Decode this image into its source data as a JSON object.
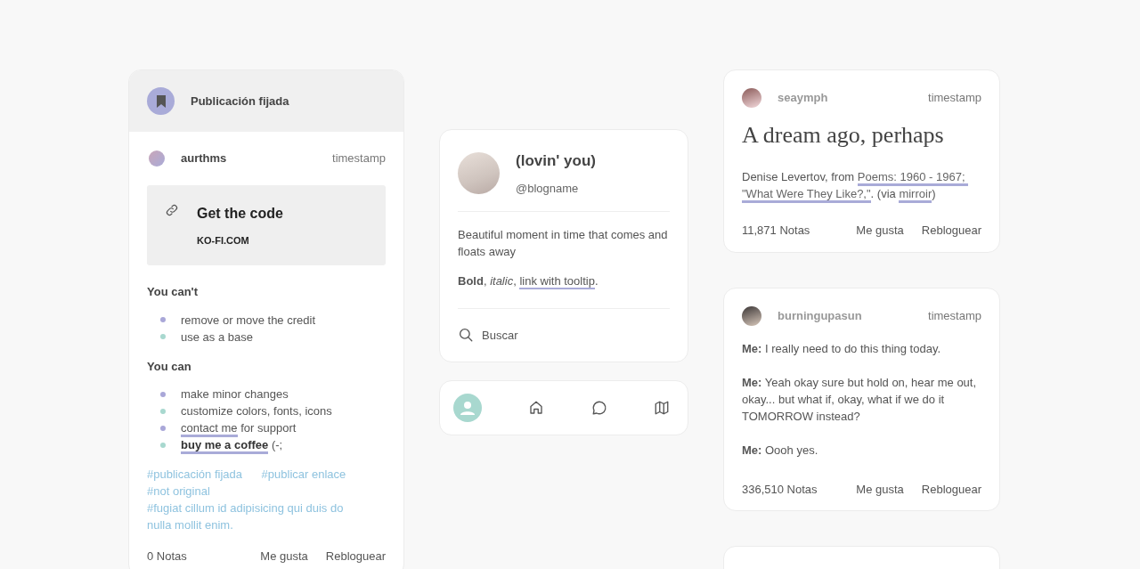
{
  "pinned_post": {
    "header": "Publicación fijada",
    "author": "aurthms",
    "timestamp": "timestamp",
    "link_card": {
      "title": "Get the code",
      "url": "KO-FI.COM"
    },
    "sections": [
      {
        "heading": "You can't",
        "items": [
          {
            "text": "remove or move the credit",
            "color": "#a9a7d8"
          },
          {
            "text": "use as a base",
            "color": "#a8d8cf"
          }
        ]
      },
      {
        "heading": "You can",
        "items": [
          {
            "text": "make minor changes",
            "color": "#a9a7d8"
          },
          {
            "text": "customize colors, fonts, icons",
            "color": "#a8d8cf"
          },
          {
            "link": "contact me",
            "text": " for support",
            "bold": false,
            "color": "#a9a7d8"
          },
          {
            "link": "buy me a coffee",
            "text": " (-;",
            "bold": true,
            "color": "#a8d8cf"
          }
        ]
      }
    ],
    "tags": [
      "#publicación fijada",
      "#publicar enlace",
      "#not original",
      "#fugiat cillum id adipisicing qui duis do nulla mollit enim."
    ],
    "footer": {
      "notes": "0 Notas",
      "like": "Me gusta",
      "reblog": "Rebloguear"
    }
  },
  "profile": {
    "title": "(lovin' you)",
    "handle": "@blogname",
    "description": "Beautiful moment in time that comes and floats away",
    "formatting": "**Bold**, *italic*, ",
    "link": "link with tooltip",
    "after_link": ".",
    "search": "Buscar"
  },
  "posts": [
    {
      "kind": "text",
      "author": "seaymph",
      "timestamp": "timestamp",
      "title": "A dream ago, perhaps",
      "body": [
        {
          "text": "Denise Levertov, from ",
          "link": false
        },
        {
          "text": "Poems: 1960 - 1967; ",
          "link": true
        },
        {
          "text": "\"What Were They Like?,\"",
          "link": true
        },
        {
          "text": ". (via ",
          "link": false
        },
        {
          "text": "mirroir",
          "link": true
        },
        {
          "text": ")",
          "link": false
        }
      ],
      "footer": {
        "notes": "11,871 Notas",
        "like": "Me gusta",
        "reblog": "Rebloguear"
      }
    },
    {
      "kind": "chat",
      "author": "burningupasun",
      "timestamp": "timestamp",
      "lines": [
        "**Me:** I really need to do this thing today.",
        "**Me:** Yeah okay sure but hold on, hear me out, okay... but what if, okay, what if we do it TOMORROW instead?",
        "**Me:** Oooh yes."
      ],
      "footer": {
        "notes": "336,510 Notas",
        "like": "Me gusta",
        "reblog": "Rebloguear"
      }
    }
  ]
}
